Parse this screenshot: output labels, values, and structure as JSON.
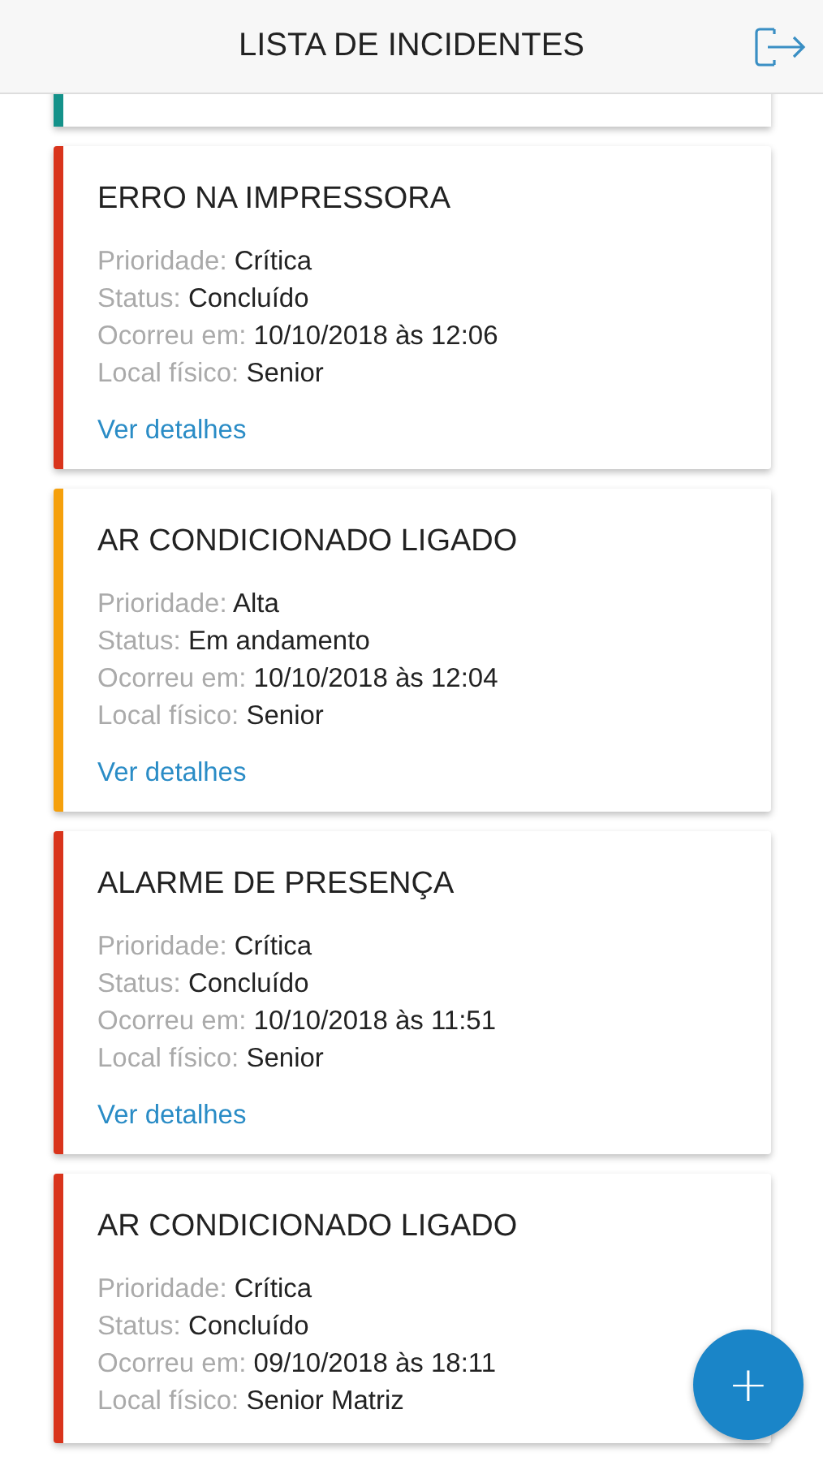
{
  "header": {
    "title": "LISTA DE INCIDENTES"
  },
  "partial_card": {
    "color": "#14928a"
  },
  "incidents": [
    {
      "title": "ERRO NA IMPRESSORA",
      "color": "#d9341c",
      "fields": [
        {
          "label": "Prioridade:",
          "value": "Crítica"
        },
        {
          "label": "Status:",
          "value": "Concluído"
        },
        {
          "label": "Ocorreu em:",
          "value": "10/10/2018 às 12:06"
        },
        {
          "label": "Local físico:",
          "value": "Senior"
        }
      ],
      "link": "Ver detalhes"
    },
    {
      "title": "AR CONDICIONADO LIGADO",
      "color": "#f5a00c",
      "fields": [
        {
          "label": "Prioridade:",
          "value": "Alta"
        },
        {
          "label": "Status:",
          "value": "Em andamento"
        },
        {
          "label": "Ocorreu em:",
          "value": "10/10/2018 às 12:04"
        },
        {
          "label": "Local físico:",
          "value": "Senior"
        }
      ],
      "link": "Ver detalhes"
    },
    {
      "title": "ALARME DE PRESENÇA",
      "color": "#d9341c",
      "fields": [
        {
          "label": "Prioridade:",
          "value": "Crítica"
        },
        {
          "label": "Status:",
          "value": "Concluído"
        },
        {
          "label": "Ocorreu em:",
          "value": "10/10/2018 às 11:51"
        },
        {
          "label": "Local físico:",
          "value": "Senior"
        }
      ],
      "link": "Ver detalhes"
    },
    {
      "title": "AR CONDICIONADO LIGADO",
      "color": "#d9341c",
      "fields": [
        {
          "label": "Prioridade:",
          "value": "Crítica"
        },
        {
          "label": "Status:",
          "value": "Concluído"
        },
        {
          "label": "Ocorreu em:",
          "value": "09/10/2018 às 18:11"
        },
        {
          "label": "Local físico:",
          "value": "Senior Matriz"
        }
      ]
    }
  ],
  "fab": {
    "label": "+"
  }
}
